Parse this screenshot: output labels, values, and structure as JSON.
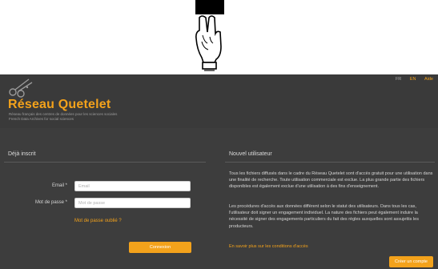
{
  "cursor": {
    "icon": "pointing-hand-cursor-icon"
  },
  "header": {
    "logo_icon": "scissors-network-logo-icon",
    "title": "Réseau Quetelet",
    "subtitle_fr": "Réseau français des centres de données pour les sciences sociales",
    "subtitle_en": "French Data Archives for social sciences",
    "languages": {
      "fr": "FR",
      "en": "EN",
      "help": "Aide"
    }
  },
  "login": {
    "title": "Déjà inscrit",
    "email_label": "Email *",
    "email_placeholder": "Email",
    "password_label": "Mot de passe *",
    "password_placeholder": "Mot de passe",
    "forgot_link": "Mot de passe oublié ?",
    "submit_label": "Connexion"
  },
  "new_user": {
    "title": "Nouvel utilisateur",
    "paragraph1": "Tous les fichiers diffusés dans le cadre du Réseau Quetelet sont d'accès gratuit pour une utilisation dans une finalité de recherche. Toute utilisation commerciale est exclue. La plus grande partie des fichiers disponibles est également exclue d'une utilisation à des fins d'enseignement.",
    "paragraph2": "Les procédures d'accès aux données diffèrent selon le statut des utilisateurs. Dans tous les cas, l'utilisateur doit signer un engagement individuel. La nature des fichiers peut également induire la nécessité de signer des engagements particuliers du fait des règles auxquelles sont assujettis les producteurs.",
    "terms_link": "En savoir plus sur les conditions d'accès",
    "create_label": "Créer un compte"
  },
  "colors": {
    "accent": "#f3a21b",
    "background": "#3d3d3d",
    "text": "#d6d6d6"
  }
}
